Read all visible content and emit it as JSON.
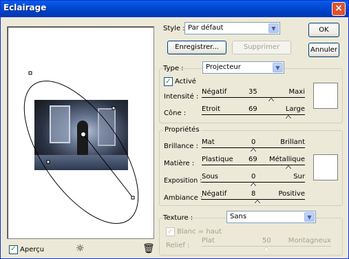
{
  "window": {
    "title": "Eclairage",
    "close_label": "×"
  },
  "style": {
    "label": "Style :",
    "value": "Par défaut",
    "save_label": "Enregistrer...",
    "delete_label": "Supprimer"
  },
  "buttons": {
    "ok": "OK",
    "cancel": "Annuler"
  },
  "type": {
    "label": "Type :",
    "value": "Projecteur",
    "active_label": "Activé",
    "active_checked": true,
    "intensity": {
      "label": "Intensité :",
      "min": "Négatif",
      "value": "35",
      "max": "Maxi",
      "position": 0.67
    },
    "cone": {
      "label": "Cône :",
      "min": "Etroit",
      "value": "69",
      "max": "Large",
      "position": 0.84
    }
  },
  "properties": {
    "title": "Propriétés",
    "gloss": {
      "label": "Brillance :",
      "min": "Mat",
      "value": "0",
      "max": "Brillant",
      "position": 0.5
    },
    "material": {
      "label": "Matière :",
      "min": "Plastique",
      "value": "69",
      "max": "Métallique",
      "position": 0.84
    },
    "exposure": {
      "label": "Exposition :",
      "min": "Sous",
      "value": "0",
      "max": "Sur",
      "position": 0.5
    },
    "ambience": {
      "label": "Ambiance :",
      "min": "Négatif",
      "value": "8",
      "max": "Positive",
      "position": 0.54
    }
  },
  "texture": {
    "label": "Texture :",
    "value": "Sans",
    "white_high_label": "Blanc = haut",
    "white_high_checked": true,
    "relief": {
      "label": "Relief :",
      "min": "Plat",
      "value": "50",
      "max": "Montagneux",
      "position": 0.5
    }
  },
  "preview": {
    "apercu_label": "Aperçu",
    "apercu_checked": true,
    "bulb_icon": "☼",
    "trash_icon": "🗑"
  }
}
